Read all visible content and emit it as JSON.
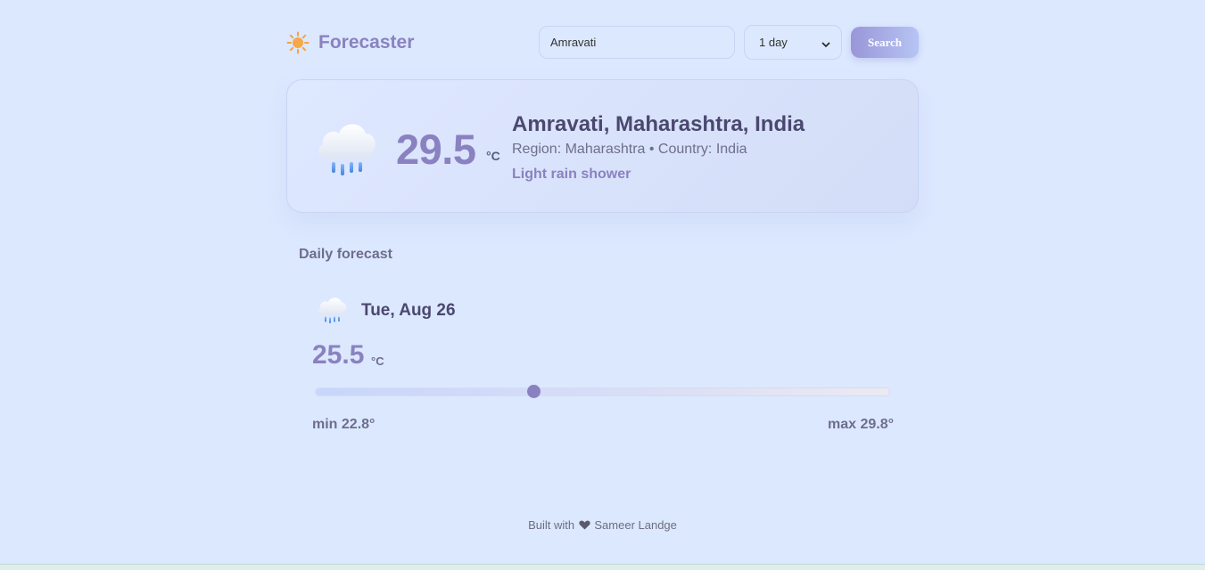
{
  "header": {
    "brand_icon": "sun-icon",
    "brand_name": "Forecaster",
    "search_value": "Amravati",
    "days_selected": "1 day",
    "search_label": "Search"
  },
  "current": {
    "icon": "rain-cloud-icon",
    "temp": "29.5",
    "unit": "°C",
    "location": "Amravati, Maharashtra, India",
    "region_line": "Region: Maharashtra • Country: India",
    "condition": "Light rain shower"
  },
  "forecast": {
    "title": "Daily forecast",
    "days": [
      {
        "icon": "rain-cloud-icon",
        "date": "Tue, Aug 26",
        "temp": "25.5",
        "unit": "°C",
        "range_position": 0.38,
        "min_label": "min 22.8°",
        "max_label": "max 29.8°"
      }
    ]
  },
  "footer": {
    "built_with": "Built with",
    "author": "Sameer Landge"
  },
  "colors": {
    "background": "#dce8fe",
    "accent": "#8a82c0",
    "text_dark": "#4b4870"
  }
}
